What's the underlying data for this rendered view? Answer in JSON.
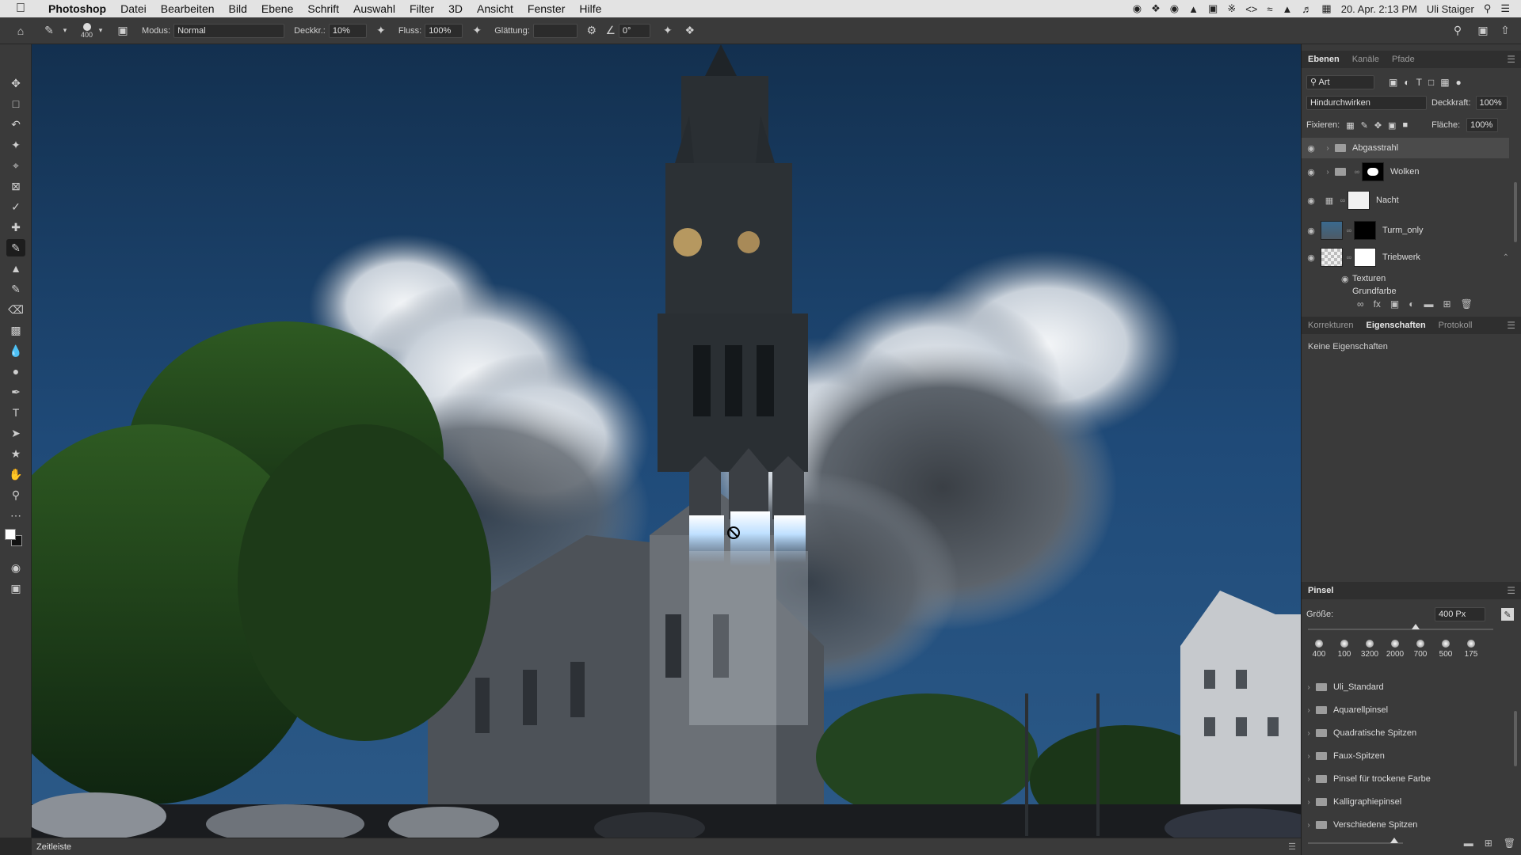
{
  "menubar": {
    "app": "Photoshop",
    "items": [
      "Datei",
      "Bearbeiten",
      "Bild",
      "Ebene",
      "Schrift",
      "Auswahl",
      "Filter",
      "3D",
      "Ansicht",
      "Fenster",
      "Hilfe"
    ],
    "clock": "20. Apr. 2:13 PM",
    "user": "Uli Staiger"
  },
  "options": {
    "brush_size": "400",
    "mode_label": "Modus:",
    "mode_value": "Normal",
    "opacity_label": "Deckkr.:",
    "opacity_value": "10%",
    "flow_label": "Fluss:",
    "flow_value": "100%",
    "smoothing_label": "Glättung:",
    "angle_value": "0°"
  },
  "layers_panel": {
    "tabs": [
      "Ebenen",
      "Kanäle",
      "Pfade"
    ],
    "filter_label": "Art",
    "blend_mode": "Hindurchwirken",
    "opacity_label": "Deckkraft:",
    "opacity_value": "100%",
    "lock_label": "Fixieren:",
    "fill_label": "Fläche:",
    "fill_value": "100%",
    "layers": [
      {
        "name": "Abgasstrahl",
        "type": "group"
      },
      {
        "name": "Wolken",
        "type": "group"
      },
      {
        "name": "Nacht",
        "type": "adjustment"
      },
      {
        "name": "Turm_only",
        "type": "layer"
      },
      {
        "name": "Triebwerk",
        "type": "layer"
      }
    ],
    "effects": [
      "Texturen",
      "Grundfarbe"
    ]
  },
  "props_panel": {
    "tabs": [
      "Korrekturen",
      "Eigenschaften",
      "Protokoll"
    ],
    "empty_text": "Keine Eigenschaften"
  },
  "brush_panel": {
    "title": "Pinsel",
    "size_label": "Größe:",
    "size_value": "400 Px",
    "size_fraction": 0.58,
    "presets": [
      "400",
      "100",
      "3200",
      "2000",
      "700",
      "500",
      "175"
    ],
    "folders": [
      "Uli_Standard",
      "Aquarellpinsel",
      "Quadratische Spitzen",
      "Faux-Spitzen",
      "Pinsel für trockene Farbe",
      "Kalligraphiepinsel",
      "Verschiedene Spitzen"
    ]
  },
  "timeline": {
    "label": "Zeitleiste"
  },
  "colors": {
    "ui_bg": "#3a3a3a",
    "sky": "#1d3a5e",
    "exhaust": "#bfe0ff"
  }
}
